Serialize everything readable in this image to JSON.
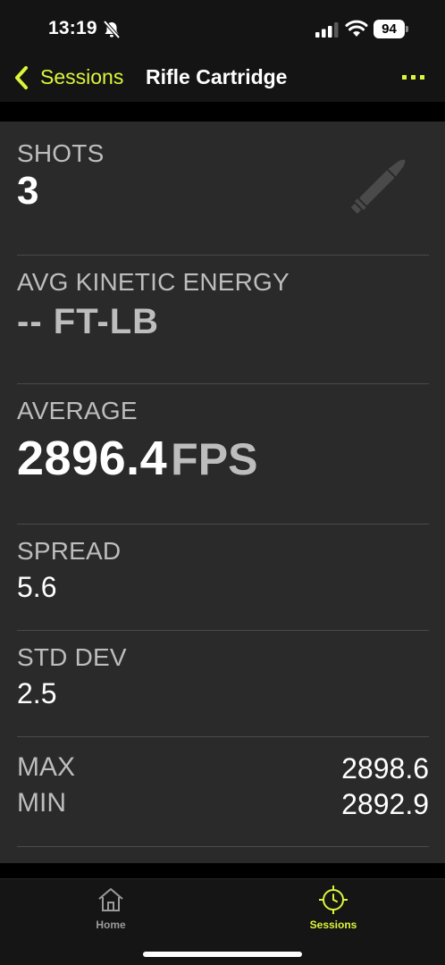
{
  "status_bar": {
    "time": "13:19",
    "battery": "94"
  },
  "nav": {
    "back_label": "Sessions",
    "title": "Rifle Cartridge"
  },
  "stats": {
    "shots_label": "SHOTS",
    "shots_value": "3",
    "ke_label": "AVG KINETIC ENERGY",
    "ke_value": "-- FT-LB",
    "avg_label": "AVERAGE",
    "avg_value": "2896.4",
    "avg_unit": "FPS",
    "spread_label": "SPREAD",
    "spread_value": "5.6",
    "stddev_label": "STD DEV",
    "stddev_value": "2.5",
    "max_label": "MAX",
    "max_value": "2898.6",
    "min_label": "MIN",
    "min_value": "2892.9"
  },
  "tabs": [
    {
      "label": "Home",
      "icon": "home-icon",
      "active": false
    },
    {
      "label": "Sessions",
      "icon": "crosshair-clock-icon",
      "active": true
    }
  ],
  "colors": {
    "accent": "#dcf53a",
    "card": "#2a2a2a",
    "muted_text": "#bdbdbd"
  }
}
